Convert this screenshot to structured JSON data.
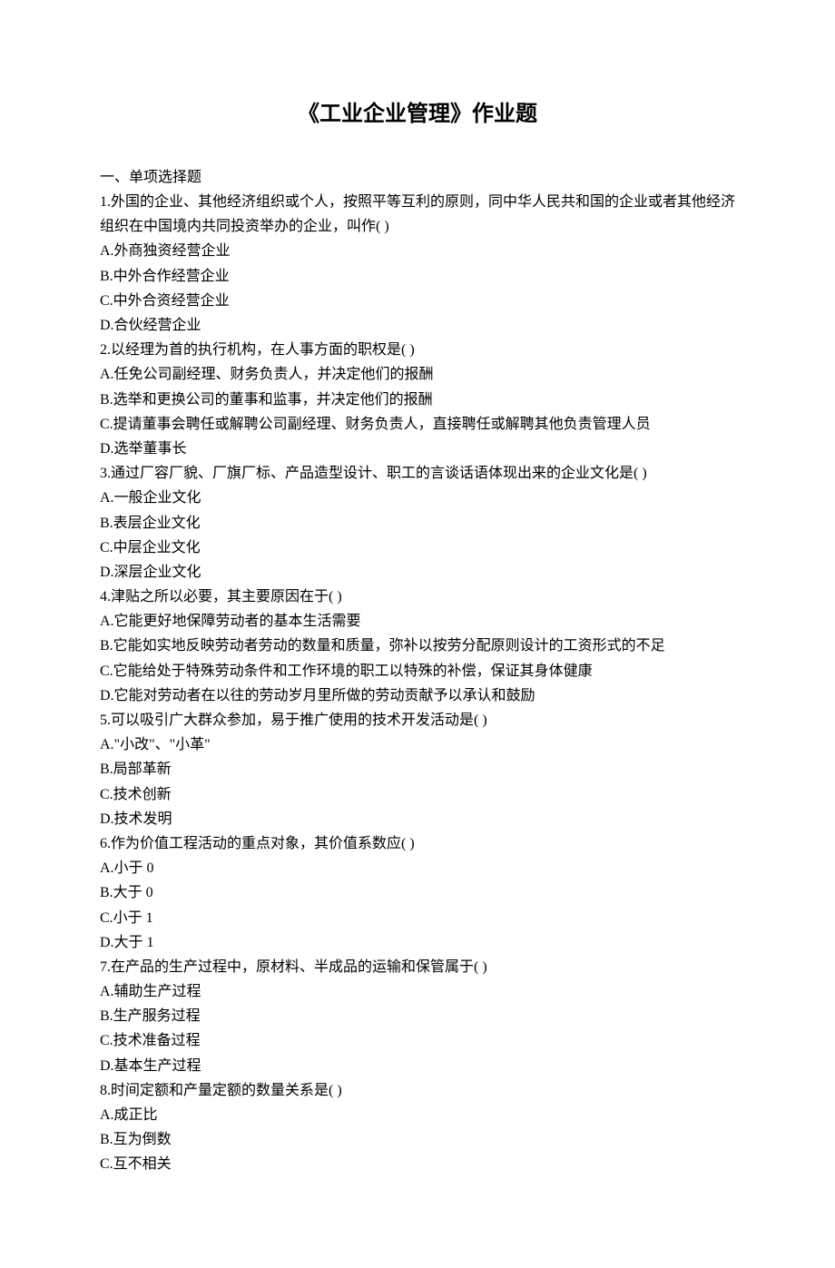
{
  "title": "《工业企业管理》作业题",
  "section_heading": "一、单项选择题",
  "questions": [
    {
      "stem": "1.外国的企业、其他经济组织或个人，按照平等互利的原则，同中华人民共和国的企业或者其他经济组织在中国境内共同投资举办的企业，叫作( )",
      "options": [
        "A.外商独资经营企业",
        "B.中外合作经营企业",
        "C.中外合资经营企业",
        "D.合伙经营企业"
      ]
    },
    {
      "stem": "2.以经理为首的执行机构，在人事方面的职权是( )",
      "options": [
        "A.任免公司副经理、财务负责人，并决定他们的报酬",
        "B.选举和更换公司的董事和监事，并决定他们的报酬",
        "C.提请董事会聘任或解聘公司副经理、财务负责人，直接聘任或解聘其他负责管理人员",
        "D.选举董事长"
      ]
    },
    {
      "stem": "3.通过厂容厂貌、厂旗厂标、产品造型设计、职工的言谈话语体现出来的企业文化是( )",
      "options": [
        "A.一般企业文化",
        "B.表层企业文化",
        "C.中层企业文化",
        "D.深层企业文化"
      ]
    },
    {
      "stem": "4.津贴之所以必要，其主要原因在于( )",
      "options": [
        "A.它能更好地保障劳动者的基本生活需要",
        "B.它能如实地反映劳动者劳动的数量和质量，弥补以按劳分配原则设计的工资形式的不足",
        "C.它能给处于特殊劳动条件和工作环境的职工以特殊的补偿，保证其身体健康",
        "D.它能对劳动者在以往的劳动岁月里所做的劳动贡献予以承认和鼓励"
      ]
    },
    {
      "stem": "5.可以吸引广大群众参加，易于推广使用的技术开发活动是( )",
      "options": [
        "A.\"小改\"、\"小革\"",
        "B.局部革新",
        "C.技术创新",
        "D.技术发明"
      ]
    },
    {
      "stem": "6.作为价值工程活动的重点对象，其价值系数应( )",
      "options": [
        "A.小于 0",
        "B.大于 0",
        "C.小于 1",
        "D.大于 1"
      ]
    },
    {
      "stem": "7.在产品的生产过程中，原材料、半成品的运输和保管属于( )",
      "options": [
        "A.辅助生产过程",
        "B.生产服务过程",
        "C.技术准备过程",
        "D.基本生产过程"
      ]
    },
    {
      "stem": "8.时间定额和产量定额的数量关系是( )",
      "options": [
        "A.成正比",
        "B.互为倒数",
        "C.互不相关"
      ]
    }
  ]
}
